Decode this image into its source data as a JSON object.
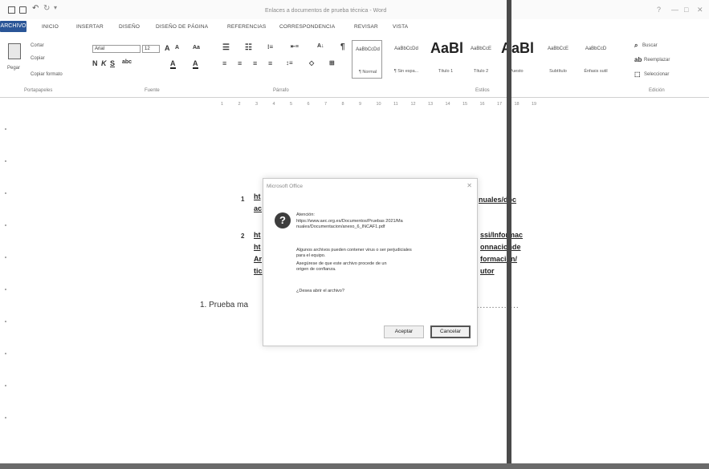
{
  "window": {
    "title": "Enlaces a documentos de prueba técnica - Word",
    "controls": [
      "?",
      "—",
      "□",
      "✕"
    ]
  },
  "ribbon_tabs": {
    "file": "ARCHIVO",
    "items": [
      "INICIO",
      "INSERTAR",
      "DISEÑO",
      "DISEÑO DE PÁGINA",
      "REFERENCIAS",
      "CORRESPONDENCIA",
      "REVISAR",
      "VISTA"
    ]
  },
  "clipboard": {
    "paste": "Pegar",
    "cut": "Cortar",
    "copy": "Copiar",
    "format_painter": "Copiar formato",
    "label": "Portapapeles"
  },
  "font": {
    "name": "Arial",
    "size": "12",
    "label": "Fuente"
  },
  "paragraph": {
    "label": "Párrafo"
  },
  "styles": {
    "label": "Estilos",
    "items": [
      {
        "sample": "AaBbCcDd",
        "name": "¶ Normal",
        "big": false
      },
      {
        "sample": "AaBbCcDd",
        "name": "¶ Sin espa...",
        "big": false
      },
      {
        "sample": "AaBl",
        "name": "Título 1",
        "big": true
      },
      {
        "sample": "AaBbCcE",
        "name": "Título 2",
        "big": false
      },
      {
        "sample": "AaBl",
        "name": "Puesto",
        "big": true
      },
      {
        "sample": "AaBbCcE",
        "name": "Subtítulo",
        "big": false
      },
      {
        "sample": "AaBbCcD",
        "name": "Énfasis sutil",
        "big": false
      }
    ]
  },
  "editing": {
    "find": "Buscar",
    "replace": "Reemplazar",
    "select": "Seleccionar",
    "label": "Edición"
  },
  "ruler_ticks": [
    "1",
    "2",
    "3",
    "4",
    "5",
    "6",
    "7",
    "8",
    "9",
    "10",
    "11",
    "12",
    "13",
    "14",
    "15",
    "16",
    "17",
    "18",
    "19"
  ],
  "document": {
    "list_numbers": [
      "1",
      "2"
    ],
    "links": [
      "ht",
      "ac",
      "ht",
      "ht",
      "Ar",
      "tic"
    ],
    "links_right": [
      "nuales/doc",
      "ssi/Informac",
      "onnacionde",
      "formacion/",
      "utor"
    ],
    "heading": "1. Prueba ma",
    "leader": "..............."
  },
  "dialog": {
    "title": "Microsoft Office",
    "close": "✕",
    "icon": "?",
    "lines": [
      "Atención:",
      "https://www.aec.org.es/Documentos/Pruebas 2021/Ma",
      "nuales/Documentacion/anexo_6_INCAF1.pdf",
      "",
      "Algunos archivos pueden contener virus o ser perjudiciales",
      "para el equipo.",
      "Asegúrese de que este archivo procede de un",
      "origen de confianza.",
      "",
      "¿Desea abrir el archivo?"
    ],
    "accept": "Aceptar",
    "cancel": "Cancelar"
  }
}
